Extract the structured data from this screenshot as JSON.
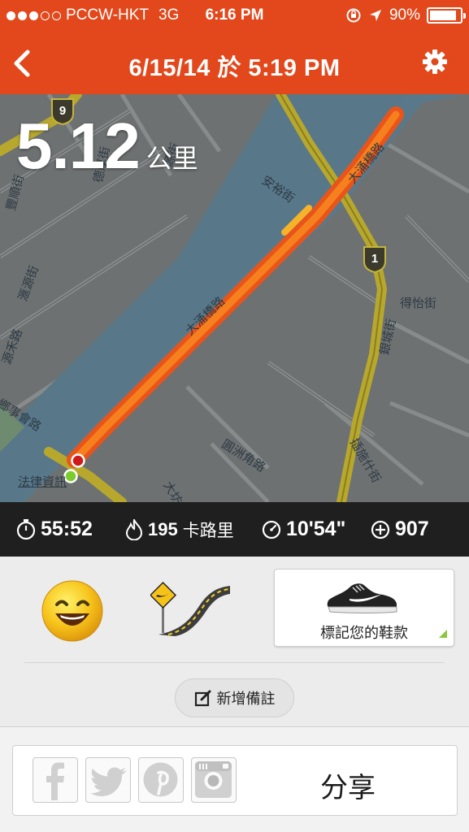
{
  "status_bar": {
    "carrier": "PCCW-HKT",
    "network": "3G",
    "time": "6:16 PM",
    "battery": "90%",
    "signal_bars_filled": 3,
    "signal_bars_total": 5
  },
  "nav": {
    "title": "6/15/14 於 5:19 PM",
    "back_icon": "chevron-left-icon",
    "settings_icon": "gear-icon"
  },
  "map": {
    "distance_value": "5.12",
    "distance_unit": "公里",
    "route_color": "#f26a1b",
    "street_labels": [
      "大涌橋路",
      "大涌橋路",
      "安裕街",
      "豐順街",
      "滙源街",
      "源禾路",
      "鄉事會路",
      "法律資訊",
      "圓洲角路",
      "德厚街",
      "源街",
      "得怡街",
      "銀城街",
      "插施什街",
      "大坊"
    ],
    "route_shields": [
      "9",
      "1"
    ]
  },
  "stats": {
    "duration": "55:52",
    "calories": "195",
    "calories_unit": "卡路里",
    "pace": "10'54\"",
    "fuel": "907"
  },
  "panel": {
    "mood_icon": "smiley-icon",
    "terrain_icon": "road-sign-icon",
    "shoe_label": "標記您的鞋款",
    "note_label": "新增備註"
  },
  "share": {
    "label": "分享",
    "icons": [
      "facebook-icon",
      "twitter-icon",
      "pinterest-icon",
      "instagram-icon"
    ]
  },
  "colors": {
    "header": "#e2481c",
    "stats_bar": "#1f1f1f",
    "route": "#f26a1b",
    "water": "#5b7e8e",
    "land": "#6d7070",
    "road_yellow": "#b7a82d"
  }
}
